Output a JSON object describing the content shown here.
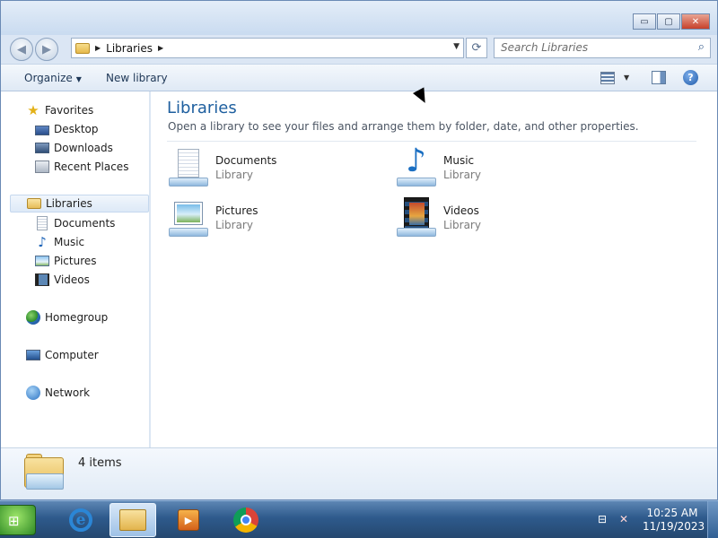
{
  "window": {
    "caption_minimize": "▭",
    "caption_maximize": "▢",
    "caption_close": "✕"
  },
  "navigation": {
    "back_glyph": "◀",
    "forward_glyph": "▶",
    "address_breadcrumb": "Libraries",
    "address_separator": "▶",
    "address_dropdown": "▼",
    "refresh_glyph": "⟳",
    "search_placeholder": "Search Libraries",
    "search_glyph": "⌕"
  },
  "command_bar": {
    "organize": "Organize",
    "organize_arrow": "▼",
    "new_library": "New library",
    "view_dropdown": "▼",
    "help_glyph": "?"
  },
  "sidebar": {
    "favorites": "Favorites",
    "favorites_items": [
      "Desktop",
      "Downloads",
      "Recent Places"
    ],
    "libraries": "Libraries",
    "libraries_items": [
      "Documents",
      "Music",
      "Pictures",
      "Videos"
    ],
    "homegroup": "Homegroup",
    "computer": "Computer",
    "network": "Network",
    "icons": {
      "favorites": "star-icon",
      "desktop": "desktop-icon",
      "downloads": "downloads-icon",
      "recent_places": "recent-places-icon",
      "libraries": "libraries-icon",
      "documents": "documents-icon",
      "music": "music-note-icon",
      "pictures": "pictures-icon",
      "videos": "videos-icon",
      "homegroup": "homegroup-icon",
      "computer": "computer-icon",
      "network": "network-icon"
    }
  },
  "content": {
    "title": "Libraries",
    "subtitle": "Open a library to see your files and arrange them by folder, date, and other properties.",
    "items": [
      {
        "name": "Documents",
        "kind": "Library",
        "icon": "documents-library-icon"
      },
      {
        "name": "Music",
        "kind": "Library",
        "icon": "music-library-icon"
      },
      {
        "name": "Pictures",
        "kind": "Library",
        "icon": "pictures-library-icon"
      },
      {
        "name": "Videos",
        "kind": "Library",
        "icon": "videos-library-icon"
      }
    ]
  },
  "details": {
    "count": "4 items",
    "icon": "libraries-folder-icon"
  },
  "taskbar": {
    "start_glyph": "⊞",
    "ie_glyph": "e",
    "media_glyph": "▶",
    "tray_network": "⊟",
    "tray_volume": "✕",
    "clock_time": "10:25 AM",
    "clock_date": "11/19/2023"
  },
  "colors": {
    "title_accent": "#1e5f9f",
    "window_frame": "#dbe6f4",
    "taskbar": "#2e5a8c"
  }
}
